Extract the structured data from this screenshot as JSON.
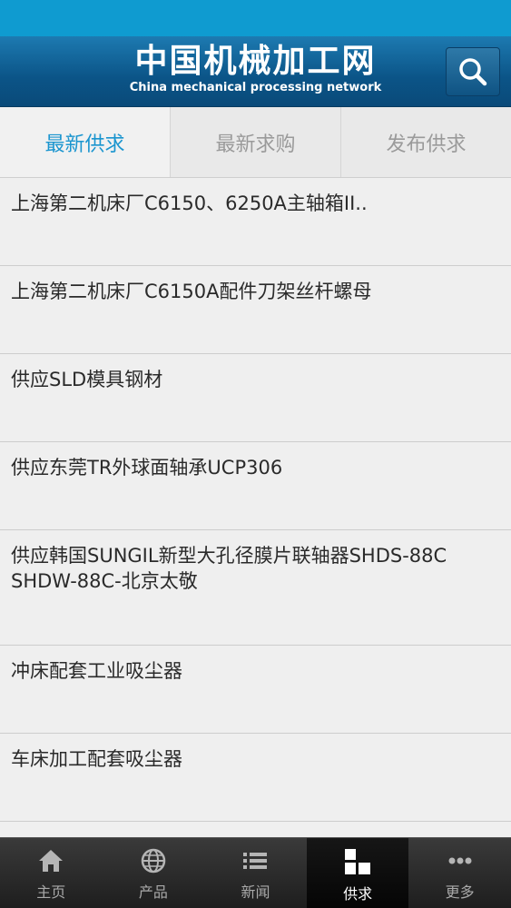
{
  "header": {
    "title_cn": "中国机械加工网",
    "title_en": "China mechanical processing network",
    "search_icon": "search-icon"
  },
  "tabs": [
    {
      "label": "最新供求",
      "active": true
    },
    {
      "label": "最新求购",
      "active": false
    },
    {
      "label": "发布供求",
      "active": false
    }
  ],
  "list": [
    {
      "title": "上海第二机床厂C6150、6250A主轴箱II.."
    },
    {
      "title": "上海第二机床厂C6150A配件刀架丝杆螺母"
    },
    {
      "title": "供应SLD模具钢材"
    },
    {
      "title": "供应东莞TR外球面轴承UCP306"
    },
    {
      "title": "供应韩国SUNGIL新型大孔径膜片联轴器SHDS-88C SHDW-88C-北京太敬"
    },
    {
      "title": "冲床配套工业吸尘器"
    },
    {
      "title": "车床加工配套吸尘器"
    }
  ],
  "bottom_nav": [
    {
      "label": "主页",
      "icon": "home-icon",
      "active": false
    },
    {
      "label": "产品",
      "icon": "globe-icon",
      "active": false
    },
    {
      "label": "新闻",
      "icon": "list-icon",
      "active": false
    },
    {
      "label": "供求",
      "icon": "grid-icon",
      "active": true
    },
    {
      "label": "更多",
      "icon": "more-icon",
      "active": false
    }
  ],
  "colors": {
    "status_bar": "#0f9bd0",
    "header": "#0b5487",
    "active_tab": "#1a95cf",
    "bottom_nav": "#2a2a2a"
  }
}
